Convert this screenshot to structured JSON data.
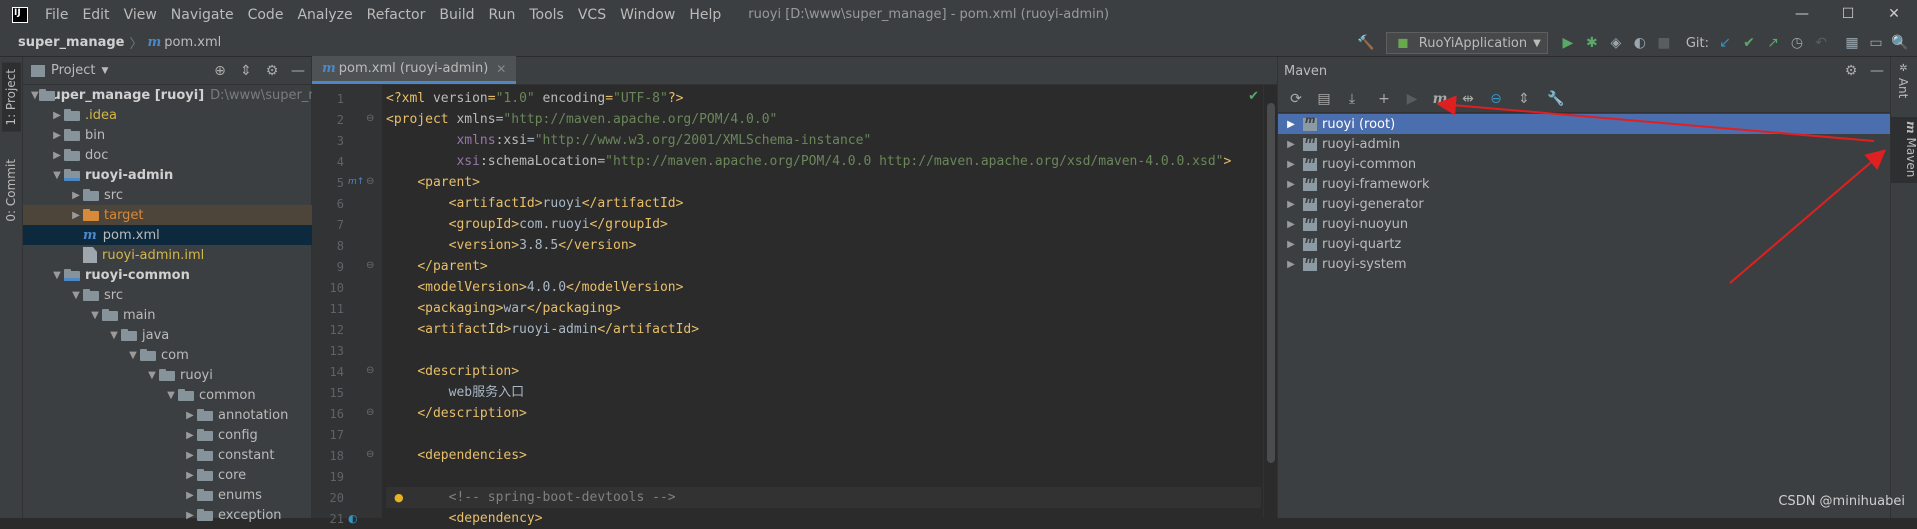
{
  "titlebar": {
    "menu": [
      "File",
      "Edit",
      "View",
      "Navigate",
      "Code",
      "Analyze",
      "Refactor",
      "Build",
      "Run",
      "Tools",
      "VCS",
      "Window",
      "Help"
    ],
    "window_title": "ruoyi [D:\\www\\super_manage] - pom.xml (ruoyi-admin)",
    "controls": [
      "—",
      "☐",
      "✕"
    ]
  },
  "navbar": {
    "project": "super_manage",
    "file": "pom.xml",
    "run_config": "RuoYiApplication",
    "git_label": "Git:"
  },
  "left_stripe": {
    "project_tab": "1: Project",
    "commit_tab": "0: Commit"
  },
  "project_panel": {
    "title": "Project",
    "items": [
      {
        "label": "super_manage [ruoyi]",
        "extra": "D:\\www\\super_manage",
        "depth": 0,
        "arrow": "▼",
        "kind": "folder",
        "style": "bold"
      },
      {
        "label": ".idea",
        "depth": 1,
        "arrow": "▶",
        "kind": "folder",
        "style": "yellow"
      },
      {
        "label": "bin",
        "depth": 1,
        "arrow": "▶",
        "kind": "folder",
        "style": ""
      },
      {
        "label": "doc",
        "depth": 1,
        "arrow": "▶",
        "kind": "folder",
        "style": ""
      },
      {
        "label": "ruoyi-admin",
        "depth": 1,
        "arrow": "▼",
        "kind": "module",
        "style": "bold"
      },
      {
        "label": "src",
        "depth": 2,
        "arrow": "▶",
        "kind": "folder",
        "style": ""
      },
      {
        "label": "target",
        "depth": 2,
        "arrow": "▶",
        "kind": "orange",
        "style": "orange",
        "row": "tgt"
      },
      {
        "label": "pom.xml",
        "depth": 2,
        "arrow": "",
        "kind": "maven",
        "style": "",
        "row": "sel"
      },
      {
        "label": "ruoyi-admin.iml",
        "depth": 2,
        "arrow": "",
        "kind": "file",
        "style": "yellow"
      },
      {
        "label": "ruoyi-common",
        "depth": 1,
        "arrow": "▼",
        "kind": "module",
        "style": "bold"
      },
      {
        "label": "src",
        "depth": 2,
        "arrow": "▼",
        "kind": "folder",
        "style": ""
      },
      {
        "label": "main",
        "depth": 3,
        "arrow": "▼",
        "kind": "folder",
        "style": ""
      },
      {
        "label": "java",
        "depth": 4,
        "arrow": "▼",
        "kind": "folder",
        "style": ""
      },
      {
        "label": "com",
        "depth": 5,
        "arrow": "▼",
        "kind": "folder",
        "style": ""
      },
      {
        "label": "ruoyi",
        "depth": 6,
        "arrow": "▼",
        "kind": "folder",
        "style": ""
      },
      {
        "label": "common",
        "depth": 7,
        "arrow": "▼",
        "kind": "folder",
        "style": ""
      },
      {
        "label": "annotation",
        "depth": 8,
        "arrow": "▶",
        "kind": "folder",
        "style": ""
      },
      {
        "label": "config",
        "depth": 8,
        "arrow": "▶",
        "kind": "folder",
        "style": ""
      },
      {
        "label": "constant",
        "depth": 8,
        "arrow": "▶",
        "kind": "folder",
        "style": ""
      },
      {
        "label": "core",
        "depth": 8,
        "arrow": "▶",
        "kind": "folder",
        "style": ""
      },
      {
        "label": "enums",
        "depth": 8,
        "arrow": "▶",
        "kind": "folder",
        "style": ""
      },
      {
        "label": "exception",
        "depth": 8,
        "arrow": "▶",
        "kind": "folder",
        "style": ""
      }
    ]
  },
  "editor": {
    "tab_label": "pom.xml (ruoyi-admin)",
    "lines": [
      {
        "n": "1",
        "parts": [
          [
            "t",
            "<?xml "
          ],
          [
            "a",
            "version"
          ],
          [
            "t",
            "="
          ],
          [
            "v",
            "\"1.0\""
          ],
          [
            "a",
            " encoding"
          ],
          [
            "t",
            "="
          ],
          [
            "v",
            "\"UTF-8\""
          ],
          [
            "t",
            "?>"
          ]
        ]
      },
      {
        "n": "2",
        "parts": [
          [
            "t",
            "<project "
          ],
          [
            "a",
            "xmlns"
          ],
          [
            "txt",
            "="
          ],
          [
            "v",
            "\"http://maven.apache.org/POM/4.0.0\""
          ]
        ]
      },
      {
        "n": "3",
        "parts": [
          [
            "txt",
            "         "
          ],
          [
            "ns",
            "xmlns"
          ],
          [
            "a",
            ":xsi"
          ],
          [
            "txt",
            "="
          ],
          [
            "v",
            "\"http://www.w3.org/2001/XMLSchema-instance\""
          ]
        ]
      },
      {
        "n": "4",
        "parts": [
          [
            "txt",
            "         "
          ],
          [
            "ns",
            "xsi"
          ],
          [
            "a",
            ":schemaLocation"
          ],
          [
            "txt",
            "="
          ],
          [
            "v",
            "\"http://maven.apache.org/POM/4.0.0 http://maven.apache.org/xsd/maven-4.0.0.xsd\""
          ],
          [
            "t",
            ">"
          ]
        ]
      },
      {
        "n": "5",
        "parts": [
          [
            "txt",
            "    "
          ],
          [
            "t",
            "<parent>"
          ]
        ]
      },
      {
        "n": "6",
        "parts": [
          [
            "txt",
            "        "
          ],
          [
            "t",
            "<artifactId>"
          ],
          [
            "txt",
            "ruoyi"
          ],
          [
            "t",
            "</artifactId>"
          ]
        ]
      },
      {
        "n": "7",
        "parts": [
          [
            "txt",
            "        "
          ],
          [
            "t",
            "<groupId>"
          ],
          [
            "txt",
            "com.ruoyi"
          ],
          [
            "t",
            "</groupId>"
          ]
        ]
      },
      {
        "n": "8",
        "parts": [
          [
            "txt",
            "        "
          ],
          [
            "t",
            "<version>"
          ],
          [
            "txt",
            "3.8.5"
          ],
          [
            "t",
            "</version>"
          ]
        ]
      },
      {
        "n": "9",
        "parts": [
          [
            "txt",
            "    "
          ],
          [
            "t",
            "</parent>"
          ]
        ]
      },
      {
        "n": "10",
        "parts": [
          [
            "txt",
            "    "
          ],
          [
            "t",
            "<modelVersion>"
          ],
          [
            "txt",
            "4.0.0"
          ],
          [
            "t",
            "</modelVersion>"
          ]
        ]
      },
      {
        "n": "11",
        "parts": [
          [
            "txt",
            "    "
          ],
          [
            "t",
            "<packaging>"
          ],
          [
            "txt",
            "war"
          ],
          [
            "t",
            "</packaging>"
          ]
        ]
      },
      {
        "n": "12",
        "parts": [
          [
            "txt",
            "    "
          ],
          [
            "t",
            "<artifactId>"
          ],
          [
            "txt",
            "ruoyi-admin"
          ],
          [
            "t",
            "</artifactId>"
          ]
        ]
      },
      {
        "n": "13",
        "parts": []
      },
      {
        "n": "14",
        "parts": [
          [
            "txt",
            "    "
          ],
          [
            "t",
            "<description>"
          ]
        ]
      },
      {
        "n": "15",
        "parts": [
          [
            "txt",
            "        web服务入口"
          ]
        ]
      },
      {
        "n": "16",
        "parts": [
          [
            "txt",
            "    "
          ],
          [
            "t",
            "</description>"
          ]
        ]
      },
      {
        "n": "17",
        "parts": []
      },
      {
        "n": "18",
        "parts": [
          [
            "txt",
            "    "
          ],
          [
            "t",
            "<dependencies>"
          ]
        ]
      },
      {
        "n": "19",
        "parts": []
      },
      {
        "n": "20",
        "parts": [
          [
            "txt",
            "        "
          ],
          [
            "cm",
            "<!-- spring-boot-devtools -->"
          ]
        ]
      },
      {
        "n": "21",
        "parts": [
          [
            "txt",
            "        "
          ],
          [
            "t",
            "<dependency>"
          ]
        ]
      }
    ]
  },
  "maven_panel": {
    "title": "Maven",
    "projects": [
      {
        "label": "ruoyi (root)",
        "selected": true
      },
      {
        "label": "ruoyi-admin",
        "selected": false
      },
      {
        "label": "ruoyi-common",
        "selected": false
      },
      {
        "label": "ruoyi-framework",
        "selected": false
      },
      {
        "label": "ruoyi-generator",
        "selected": false
      },
      {
        "label": "ruoyi-nuoyun",
        "selected": false
      },
      {
        "label": "ruoyi-quartz",
        "selected": false
      },
      {
        "label": "ruoyi-system",
        "selected": false
      }
    ]
  },
  "right_stripe": {
    "ant_tab": "Ant",
    "maven_tab": "Maven"
  },
  "watermark": "CSDN @minihuabei",
  "colors": {
    "accent": "#4a88c7",
    "selection": "#4b6eaf",
    "annotation_arrow": "#e02020"
  }
}
